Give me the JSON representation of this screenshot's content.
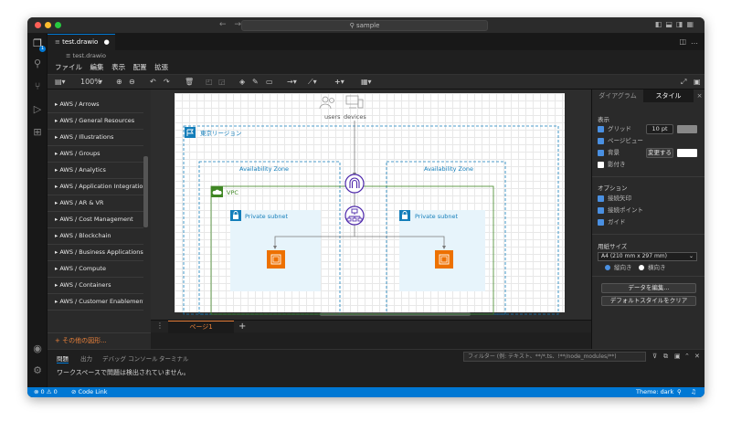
{
  "titlebar": {
    "search_text": "sample",
    "nav_back": "←",
    "nav_forward": "→"
  },
  "tab": {
    "filename": "test.drawio",
    "modified_dot": "●"
  },
  "breadcrumb": {
    "path": "test.drawio"
  },
  "menu": [
    "ファイル",
    "編集",
    "表示",
    "配置",
    "拡張"
  ],
  "toolbar": {
    "zoom": "100%"
  },
  "libraries": [
    "AWS / Arrows",
    "AWS / General Resources",
    "AWS / Illustrations",
    "AWS / Groups",
    "AWS / Analytics",
    "AWS / Application Integration",
    "AWS / AR & VR",
    "AWS / Cost Management",
    "AWS / Blockchain",
    "AWS / Business Applications",
    "AWS / Compute",
    "AWS / Containers",
    "AWS / Customer Enablement"
  ],
  "more_shapes": "+ その他の図形...",
  "diagram": {
    "region_label": "東京リージョン",
    "az_left": "Availability Zone",
    "az_right": "Availability Zone",
    "vpc_label": "VPC",
    "subnet_left": "Private subnet",
    "subnet_right": "Private subnet",
    "users": "users",
    "devices": "devices"
  },
  "pages": {
    "current": "ページ1",
    "add": "+"
  },
  "right_panel": {
    "tab_diagram": "ダイアグラム",
    "tab_style": "スタイル",
    "close": "×",
    "view_title": "表示",
    "grid": "グリッド",
    "grid_size": "10 pt",
    "page_view": "ページビュー",
    "background": "背景",
    "change_button": "変更する",
    "shadow": "影付き",
    "options_title": "オプション",
    "connection_arrows": "接続矢印",
    "connection_points": "接続ポイント",
    "guides": "ガイド",
    "paper_size_title": "用紙サイズ",
    "paper_size": "A4 (210 mm x 297 mm)",
    "portrait": "縦向き",
    "landscape": "横向き",
    "edit_data": "データを編集...",
    "clear_style": "デフォルトスタイルをクリア",
    "grid_checked": true,
    "page_view_checked": true,
    "background_checked": true,
    "shadow_checked": false,
    "connection_arrows_checked": true,
    "connection_points_checked": true,
    "guides_checked": true,
    "orientation": "portrait"
  },
  "bottom_panel": {
    "tabs": [
      "問題",
      "出力",
      "デバッグ コンソール",
      "ターミナル"
    ],
    "active_tab": "問題",
    "filter_placeholder": "フィルター (例: テキスト、**/*.ts、!**/node_modules/**)",
    "message": "ワークスペースで問題は検出されていません。"
  },
  "status": {
    "errors": "0",
    "warnings": "0",
    "code_link": "Code Link",
    "theme": "Theme: dark"
  },
  "colors": {
    "accent": "#0078d4",
    "orange": "#e8803a",
    "aws_compute": "#ed7100",
    "vpc_green": "#3f8624",
    "subnet_fill": "#e7f4fb",
    "region_blue": "#147eba",
    "elb_purple": "#4d27aa"
  }
}
